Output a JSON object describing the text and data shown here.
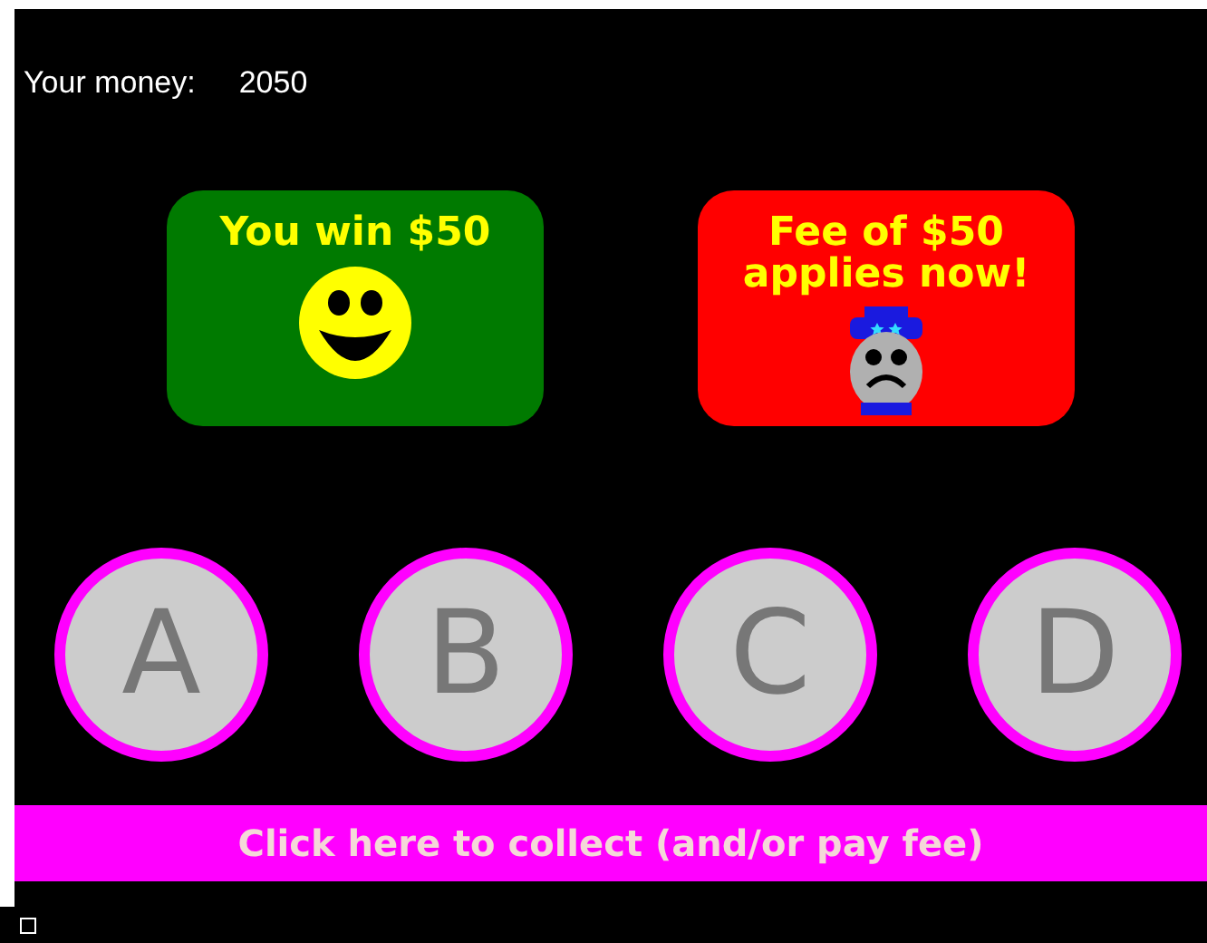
{
  "money": {
    "label": "Your money:",
    "value": "2050"
  },
  "cards": [
    {
      "kind": "win",
      "color": "#007a00",
      "text": "You win $50"
    },
    {
      "kind": "fee",
      "color": "#ff0000",
      "text": "Fee of $50 applies now!"
    }
  ],
  "choices": [
    "A",
    "B",
    "C",
    "D"
  ],
  "collect_button": "Click here to collect (and/or pay fee)",
  "footer_checkbox": {
    "checked": false
  }
}
